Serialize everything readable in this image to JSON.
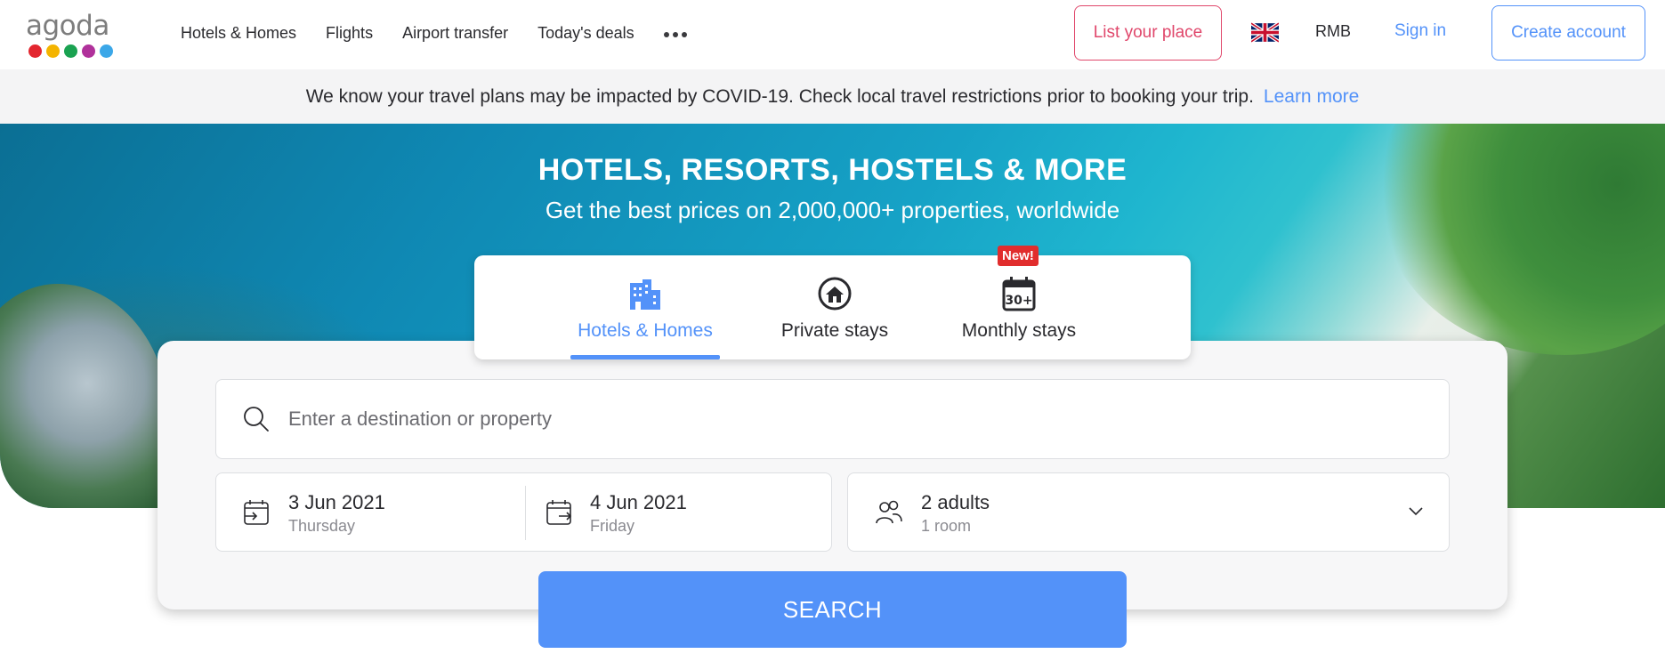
{
  "brand": {
    "name": "agoda",
    "dot_colors": [
      "#e3262f",
      "#f4b400",
      "#1aa251",
      "#b0319b",
      "#3ba7e8"
    ]
  },
  "nav": {
    "links": [
      "Hotels & Homes",
      "Flights",
      "Airport transfer",
      "Today's deals"
    ],
    "more_icon": "more-dots-icon",
    "list_place": "List your place",
    "flag_icon": "uk-flag-icon",
    "currency": "RMB",
    "sign_in": "Sign in",
    "create_account": "Create account"
  },
  "banner": {
    "text": "We know your travel plans may be impacted by COVID-19. Check local travel restrictions prior to booking your trip.",
    "link": "Learn more"
  },
  "hero": {
    "title": "HOTELS, RESORTS, HOSTELS & MORE",
    "subtitle": "Get the best prices on 2,000,000+ properties, worldwide"
  },
  "tabs": [
    {
      "label": "Hotels & Homes",
      "icon": "hotel-building-icon",
      "active": true
    },
    {
      "label": "Private stays",
      "icon": "house-icon",
      "active": false
    },
    {
      "label": "Monthly stays",
      "icon": "calendar-30-icon",
      "active": false,
      "badge": "New!"
    }
  ],
  "search": {
    "destination_placeholder": "Enter a destination or property",
    "destination_value": "",
    "checkin": {
      "date": "3 Jun 2021",
      "day": "Thursday"
    },
    "checkout": {
      "date": "4 Jun 2021",
      "day": "Friday"
    },
    "guests": {
      "main": "2 adults",
      "sub": "1 room"
    },
    "button": "SEARCH"
  },
  "colors": {
    "accent": "#5392f9",
    "list_place_accent": "#e0476b",
    "badge": "#e12d2d"
  }
}
